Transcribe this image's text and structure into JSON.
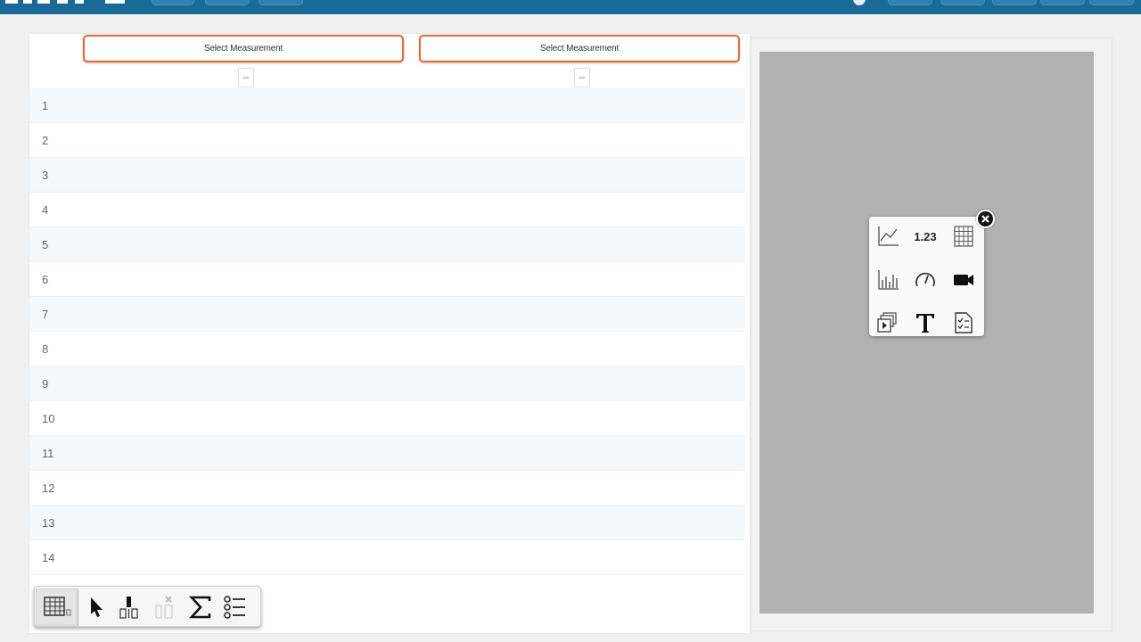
{
  "table": {
    "columns": [
      {
        "header": "Select Measurement",
        "unit": "--"
      },
      {
        "header": "Select Measurement",
        "unit": "--"
      }
    ],
    "row_numbers": [
      "1",
      "2",
      "3",
      "4",
      "5",
      "6",
      "7",
      "8",
      "9",
      "10",
      "11",
      "12",
      "13",
      "14"
    ]
  },
  "toolbar": {
    "buttons": [
      {
        "icon": "table-view-icon",
        "active": true
      },
      {
        "icon": "select-pointer-icon"
      },
      {
        "icon": "insert-row-icon"
      },
      {
        "icon": "delete-row-icon",
        "disabled": true
      },
      {
        "icon": "sigma-statistics-icon"
      },
      {
        "icon": "list-options-icon"
      }
    ]
  },
  "display_picker": {
    "digits_label": "1.23",
    "options": [
      "graph-icon",
      "digits-icon",
      "table-icon",
      "bar-graph-icon",
      "meter-gauge-icon",
      "video-camera-icon",
      "image-media-icon",
      "text-icon",
      "checklist-icon"
    ],
    "close_icon": "close-icon"
  },
  "colors": {
    "topbar": "#1a6a97",
    "column_header_border": "#e86b2e",
    "gray_area": "#b2b2b2",
    "alt_row": "#f3f9fd"
  }
}
